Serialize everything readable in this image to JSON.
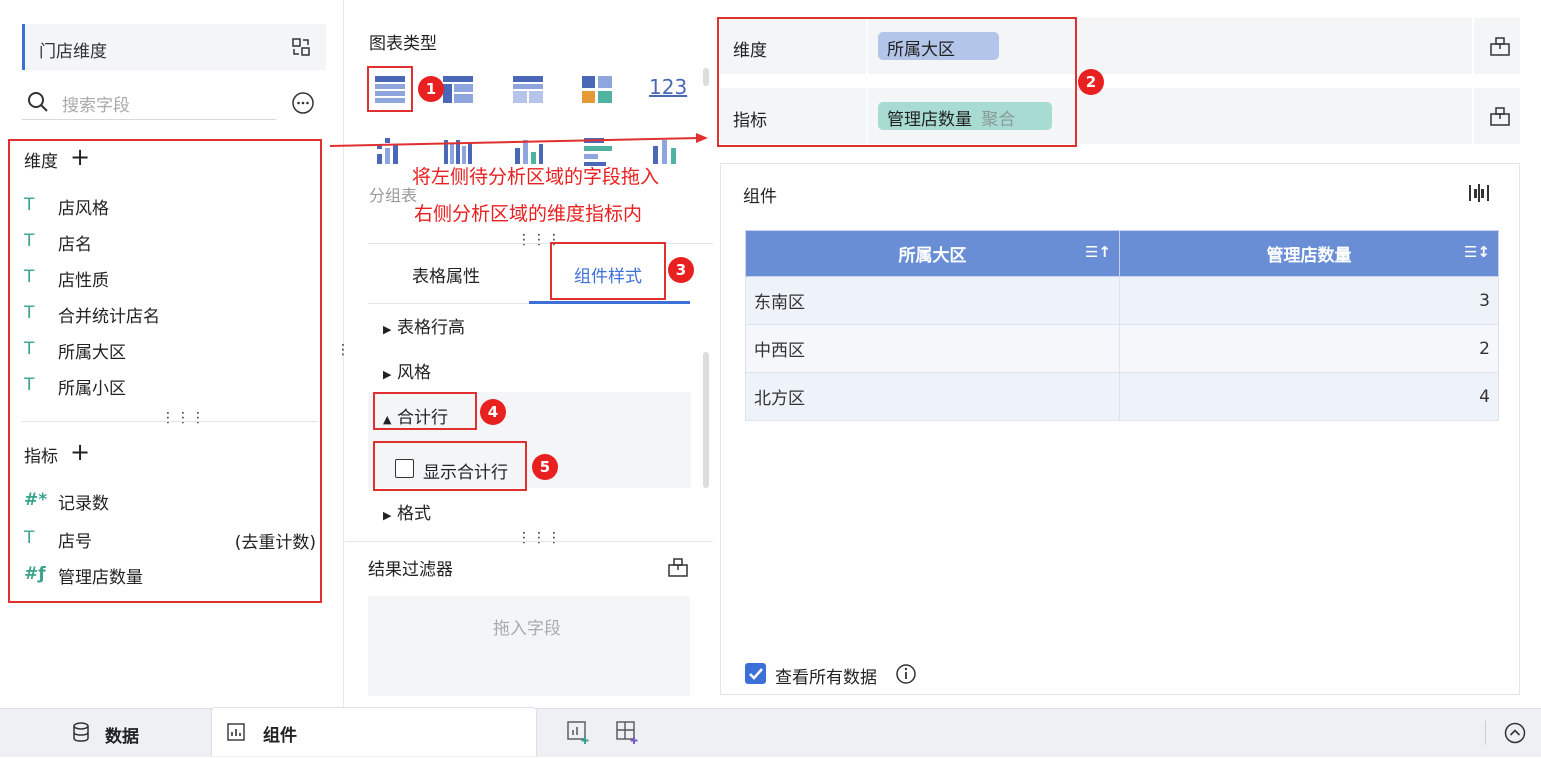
{
  "left": {
    "dataset_name": "门店维度",
    "search_placeholder": "搜索字段",
    "dimension_title": "维度",
    "dimensions": [
      "店风格",
      "店名",
      "店性质",
      "合并统计店名",
      "所属大区",
      "所属小区"
    ],
    "metric_title": "指标",
    "metrics": [
      {
        "label": "记录数",
        "icon": "hash-star-icon",
        "note": ""
      },
      {
        "label": "店号",
        "icon": "text-icon",
        "note": "(去重计数)"
      },
      {
        "label": "管理店数量",
        "icon": "hash-calc-icon",
        "note": ""
      }
    ]
  },
  "middle": {
    "chart_type_title": "图表类型",
    "chart_icon_123": "123",
    "group_table_label": "分组表",
    "tabs": [
      "表格属性",
      "组件样式"
    ],
    "sections": [
      "表格行高",
      "风格",
      "合计行",
      "格式"
    ],
    "show_total_checkbox": "显示合计行",
    "result_filter_title": "结果过滤器",
    "drop_placeholder": "拖入字段"
  },
  "annotation": {
    "line1": "将左侧待分析区域的字段拖入",
    "line2": "右侧分析区域的维度指标内",
    "markers": [
      "1",
      "2",
      "3",
      "4",
      "5"
    ],
    "color": "#e82020"
  },
  "right": {
    "dimension_label": "维度",
    "dimension_chip": "所属大区",
    "metric_label": "指标",
    "metric_chip": "管理店数量",
    "metric_chip_agg": "聚合",
    "component_title": "组件",
    "table": {
      "headers": [
        "所属大区",
        "管理店数量"
      ],
      "rows": [
        [
          "东南区",
          "3"
        ],
        [
          "中西区",
          "2"
        ],
        [
          "北方区",
          "4"
        ]
      ]
    },
    "view_all_label": "查看所有数据"
  },
  "bottom": {
    "data_tab": "数据",
    "component_tab": "组件"
  },
  "colors": {
    "accent": "#3d6fd8",
    "header_blue": "#6a8ed6",
    "dim_chip": "#b3c6ea",
    "metric_chip": "#a8dcd3",
    "annotation_red": "#e03030"
  }
}
